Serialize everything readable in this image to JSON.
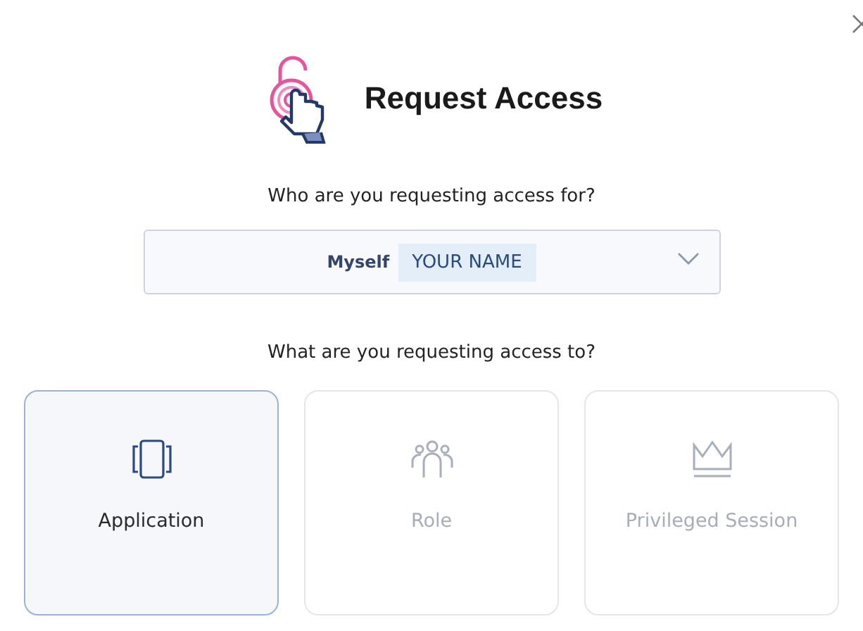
{
  "dialog": {
    "title": "Request Access"
  },
  "requester": {
    "question": "Who are you requesting access for?",
    "prefix": "Myself",
    "value": "YOUR NAME"
  },
  "target": {
    "question": "What are you requesting access to?"
  },
  "options": [
    {
      "kind": "application",
      "label": "Application",
      "selected": true
    },
    {
      "kind": "role",
      "label": "Role",
      "selected": false
    },
    {
      "kind": "session",
      "label": "Privileged Session",
      "selected": false
    }
  ]
}
